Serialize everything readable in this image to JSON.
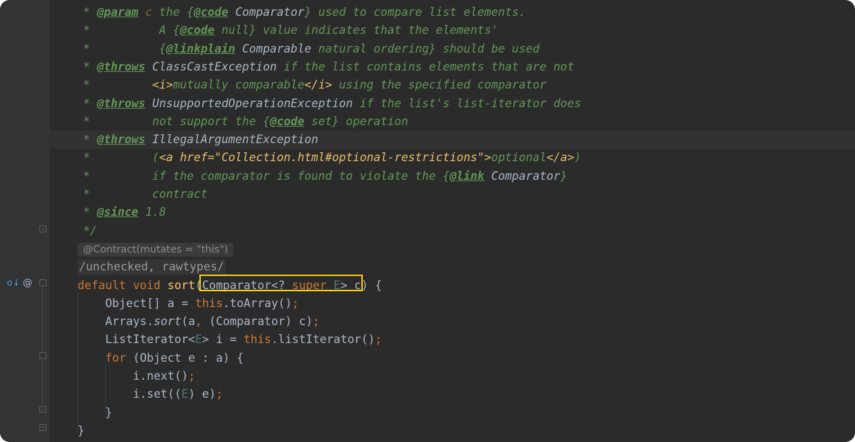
{
  "javadoc": [
    {
      "star": "* ",
      "tag": "@param",
      "parts": [
        {
          "t": " c ",
          "c": "tagref2"
        },
        {
          "t": "the {",
          "c": "doc"
        },
        {
          "t": "@code",
          "c": "tag"
        },
        {
          "t": " Comparator",
          "c": "tagref"
        },
        {
          "t": "} used to compare list elements.",
          "c": "doc"
        }
      ]
    },
    {
      "star": "*          ",
      "parts": [
        {
          "t": "A {",
          "c": "doc"
        },
        {
          "t": "@code",
          "c": "tag"
        },
        {
          "t": " null} value indicates that the elements'",
          "c": "doc"
        }
      ]
    },
    {
      "star": "*          ",
      "parts": [
        {
          "t": "{",
          "c": "doc"
        },
        {
          "t": "@linkplain",
          "c": "tag"
        },
        {
          "t": " Comparable",
          "c": "tagref"
        },
        {
          "t": " natural ordering} should be used",
          "c": "doc"
        }
      ]
    },
    {
      "star": "* ",
      "tag": "@throws",
      "parts": [
        {
          "t": " ClassCastException",
          "c": "tagref"
        },
        {
          "t": " if the list contains elements that are not",
          "c": "doc"
        }
      ]
    },
    {
      "star": "*         ",
      "parts": [
        {
          "t": "<i>",
          "c": "html"
        },
        {
          "t": "mutually comparable",
          "c": "doc"
        },
        {
          "t": "</i>",
          "c": "html"
        },
        {
          "t": " using the specified comparator",
          "c": "doc"
        }
      ]
    },
    {
      "star": "* ",
      "tag": "@throws",
      "parts": [
        {
          "t": " UnsupportedOperationException",
          "c": "tagref"
        },
        {
          "t": " if the list's list-iterator does",
          "c": "doc"
        }
      ]
    },
    {
      "star": "*         ",
      "parts": [
        {
          "t": "not support the {",
          "c": "doc"
        },
        {
          "t": "@code",
          "c": "tag"
        },
        {
          "t": " set} operation",
          "c": "doc"
        }
      ]
    },
    {
      "star": "* ",
      "tag": "@throws",
      "parts": [
        {
          "t": " IllegalArgumentException",
          "c": "tagref"
        }
      ]
    },
    {
      "star": "*         ",
      "parts": [
        {
          "t": "(",
          "c": "doc"
        },
        {
          "t": "<a href=\"Collection.html#optional-restrictions\">",
          "c": "html"
        },
        {
          "t": "optional",
          "c": "doc"
        },
        {
          "t": "</a>",
          "c": "html"
        },
        {
          "t": ")",
          "c": "doc"
        }
      ]
    },
    {
      "star": "*         ",
      "parts": [
        {
          "t": "if the comparator is found to violate the {",
          "c": "doc"
        },
        {
          "t": "@link",
          "c": "tag"
        },
        {
          "t": " Comparator",
          "c": "tagref"
        },
        {
          "t": "}",
          "c": "doc"
        }
      ]
    },
    {
      "star": "*         ",
      "parts": [
        {
          "t": "contract",
          "c": "doc"
        }
      ]
    },
    {
      "star": "* ",
      "tag": "@since",
      "parts": [
        {
          "t": " 1.8",
          "c": "doc"
        }
      ]
    },
    {
      "star": "*/",
      "parts": []
    }
  ],
  "inlay_annotation": "@Contract(mutates = \"this\")",
  "suppress_comment": "/unchecked, rawtypes/",
  "code": {
    "signature": [
      {
        "t": "default",
        "c": "kw"
      },
      {
        "t": " "
      },
      {
        "t": "void",
        "c": "kw"
      },
      {
        "t": " "
      },
      {
        "t": "sort",
        "c": "fn"
      },
      {
        "t": "("
      },
      {
        "t": "Comparator<? "
      },
      {
        "t": "super",
        "c": "kw"
      },
      {
        "t": " "
      },
      {
        "t": "E",
        "c": "tp"
      },
      {
        "t": "> c"
      },
      {
        "t": ") {"
      }
    ],
    "lines": [
      {
        "indent": 1,
        "parts": [
          {
            "t": "Object[] a = "
          },
          {
            "t": "this",
            "c": "kw"
          },
          {
            "t": ".toArray()"
          },
          {
            "t": ";",
            "c": "kw"
          }
        ]
      },
      {
        "indent": 1,
        "parts": [
          {
            "t": "Arrays."
          },
          {
            "t": "sort",
            "c": "it"
          },
          {
            "t": "(a"
          },
          {
            "t": ",",
            "c": "kw"
          },
          {
            "t": " (Comparator) c)"
          },
          {
            "t": ";",
            "c": "kw"
          }
        ]
      },
      {
        "indent": 1,
        "parts": [
          {
            "t": "ListIterator<"
          },
          {
            "t": "E",
            "c": "tp"
          },
          {
            "t": "> i = "
          },
          {
            "t": "this",
            "c": "kw"
          },
          {
            "t": ".listIterator()"
          },
          {
            "t": ";",
            "c": "kw"
          }
        ]
      },
      {
        "indent": 1,
        "parts": [
          {
            "t": "for",
            "c": "kw"
          },
          {
            "t": " (Object e : a) {"
          }
        ]
      },
      {
        "indent": 2,
        "parts": [
          {
            "t": "i.next()"
          },
          {
            "t": ";",
            "c": "kw"
          }
        ]
      },
      {
        "indent": 2,
        "parts": [
          {
            "t": "i.set(("
          },
          {
            "t": "E",
            "c": "tp"
          },
          {
            "t": ") e)"
          },
          {
            "t": ";",
            "c": "kw"
          }
        ]
      },
      {
        "indent": 1,
        "parts": [
          {
            "t": "}"
          }
        ]
      },
      {
        "indent": 0,
        "parts": [
          {
            "t": "}"
          }
        ]
      }
    ]
  },
  "gutter": {
    "icons": [
      "override-method-icon",
      "annotation-icon"
    ],
    "icon_glyphs": [
      "o↓",
      "@"
    ]
  },
  "colors": {
    "background": "#2b2b2b",
    "doc_comment": "#629755",
    "keyword": "#cc7832",
    "method_decl": "#ffc66d",
    "type_param": "#507874",
    "highlight_box": "#ffd600"
  }
}
